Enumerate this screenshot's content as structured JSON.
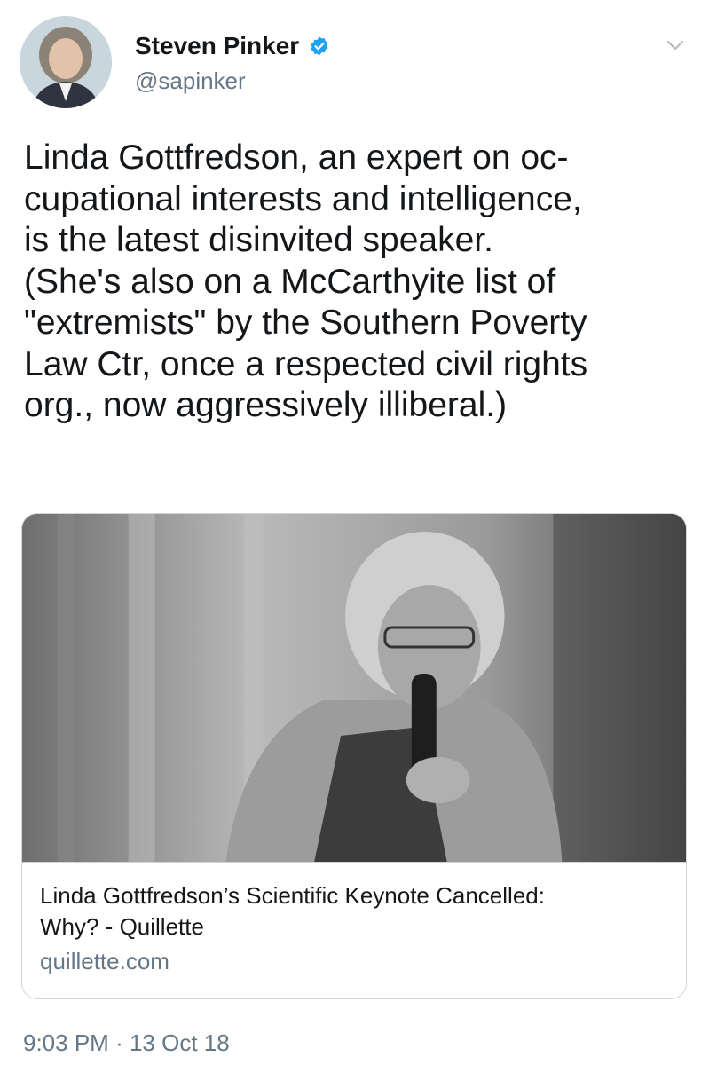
{
  "author": {
    "display_name": "Steven Pinker",
    "handle": "@sapinker",
    "verified": true,
    "avatar_icon": "profile-photo",
    "verified_icon": "verified-badge-icon",
    "verified_color": "#1da1f2"
  },
  "menu": {
    "icon": "chevron-down-icon"
  },
  "tweet": {
    "lines": [
      "Linda Gottfredson, an expert on oc-",
      "cupational interests and intelligence,",
      "is the latest disinvited speaker.",
      "(She's also on a McCarthyite list of",
      "\"extremists\" by the Southern Poverty",
      "Law Ctr, once a respected civil rights",
      "org., now aggressively illiberal.)"
    ]
  },
  "card": {
    "title_line1": "Linda Gottfredson’s Scientific Keynote Cancelled:",
    "title_line2": "Why? - Quillette",
    "domain": "quillette.com"
  },
  "meta": {
    "time": "9:03 PM",
    "separator": "·",
    "date": "13 Oct 18"
  },
  "colors": {
    "text": "#14171a",
    "secondary": "#657786",
    "border": "#ccd6dd"
  }
}
